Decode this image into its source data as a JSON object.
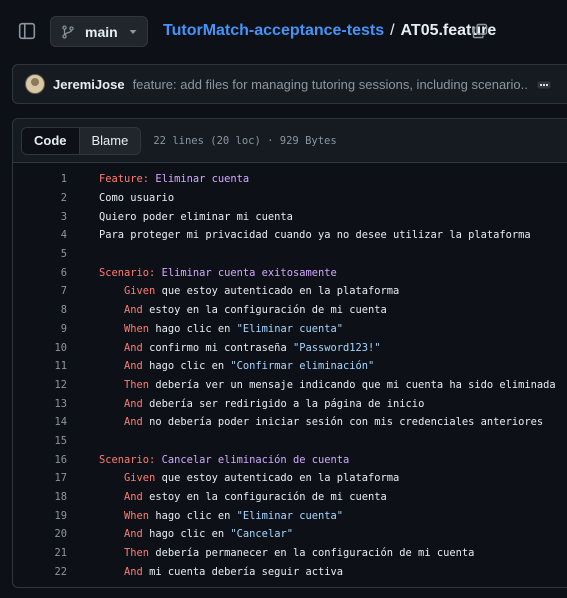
{
  "topbar": {
    "branch": "main",
    "repo": "TutorMatch-acceptance-tests",
    "separator": "/",
    "file": "AT05.feature",
    "icons": {
      "sidebar": "sidebar-toggle-icon",
      "branch": "git-branch-icon",
      "caret": "chevron-down-icon",
      "copy": "copy-icon"
    }
  },
  "commit": {
    "author": "JeremiJose",
    "message": "feature: add files for managing tutoring sessions, including scenario...",
    "icons": {
      "more": "ellipsis-icon"
    }
  },
  "file_header": {
    "tabs": [
      {
        "label": "Code",
        "active": true
      },
      {
        "label": "Blame",
        "active": false
      }
    ],
    "info": "22 lines (20 loc) · 929 Bytes"
  },
  "colors": {
    "keyword": "#ff7b72",
    "string": "#a5d6ff",
    "title": "#d2a8ff",
    "link": "#4493f8",
    "text": "#e6edf3",
    "muted": "#8d96a0"
  },
  "lines": [
    {
      "n": "1",
      "indent": "",
      "kw": "Feature:",
      "text": " ",
      "title": "Eliminar cuenta",
      "str": "",
      "rest": ""
    },
    {
      "n": "2",
      "indent": "",
      "kw": "",
      "text": "Como usuario",
      "title": "",
      "str": "",
      "rest": ""
    },
    {
      "n": "3",
      "indent": "",
      "kw": "",
      "text": "Quiero poder eliminar mi cuenta",
      "title": "",
      "str": "",
      "rest": ""
    },
    {
      "n": "4",
      "indent": "",
      "kw": "",
      "text": "Para proteger mi privacidad cuando ya no desee utilizar la plataforma",
      "title": "",
      "str": "",
      "rest": ""
    },
    {
      "n": "5",
      "indent": "",
      "kw": "",
      "text": "",
      "title": "",
      "str": "",
      "rest": ""
    },
    {
      "n": "6",
      "indent": "",
      "kw": "Scenario:",
      "text": " ",
      "title": "Eliminar cuenta exitosamente",
      "str": "",
      "rest": ""
    },
    {
      "n": "7",
      "indent": "    ",
      "kw": "Given",
      "text": " que estoy autenticado en la plataforma",
      "title": "",
      "str": "",
      "rest": ""
    },
    {
      "n": "8",
      "indent": "    ",
      "kw": "And",
      "text": " estoy en la configuración de mi cuenta",
      "title": "",
      "str": "",
      "rest": ""
    },
    {
      "n": "9",
      "indent": "    ",
      "kw": "When",
      "text": " hago clic en ",
      "title": "",
      "str": "\"Eliminar cuenta\"",
      "rest": ""
    },
    {
      "n": "10",
      "indent": "    ",
      "kw": "And",
      "text": " confirmo mi contraseña ",
      "title": "",
      "str": "\"Password123!\"",
      "rest": ""
    },
    {
      "n": "11",
      "indent": "    ",
      "kw": "And",
      "text": " hago clic en ",
      "title": "",
      "str": "\"Confirmar eliminación\"",
      "rest": ""
    },
    {
      "n": "12",
      "indent": "    ",
      "kw": "Then",
      "text": " debería ver un mensaje indicando que mi cuenta ha sido eliminada",
      "title": "",
      "str": "",
      "rest": ""
    },
    {
      "n": "13",
      "indent": "    ",
      "kw": "And",
      "text": " debería ser redirigido a la página de inicio",
      "title": "",
      "str": "",
      "rest": ""
    },
    {
      "n": "14",
      "indent": "    ",
      "kw": "And",
      "text": " no debería poder iniciar sesión con mis credenciales anteriores",
      "title": "",
      "str": "",
      "rest": ""
    },
    {
      "n": "15",
      "indent": "",
      "kw": "",
      "text": "",
      "title": "",
      "str": "",
      "rest": ""
    },
    {
      "n": "16",
      "indent": "",
      "kw": "Scenario:",
      "text": " ",
      "title": "Cancelar eliminación de cuenta",
      "str": "",
      "rest": ""
    },
    {
      "n": "17",
      "indent": "    ",
      "kw": "Given",
      "text": " que estoy autenticado en la plataforma",
      "title": "",
      "str": "",
      "rest": ""
    },
    {
      "n": "18",
      "indent": "    ",
      "kw": "And",
      "text": " estoy en la configuración de mi cuenta",
      "title": "",
      "str": "",
      "rest": ""
    },
    {
      "n": "19",
      "indent": "    ",
      "kw": "When",
      "text": " hago clic en ",
      "title": "",
      "str": "\"Eliminar cuenta\"",
      "rest": ""
    },
    {
      "n": "20",
      "indent": "    ",
      "kw": "And",
      "text": " hago clic en ",
      "title": "",
      "str": "\"Cancelar\"",
      "rest": ""
    },
    {
      "n": "21",
      "indent": "    ",
      "kw": "Then",
      "text": " debería permanecer en la configuración de mi cuenta",
      "title": "",
      "str": "",
      "rest": ""
    },
    {
      "n": "22",
      "indent": "    ",
      "kw": "And",
      "text": " mi cuenta debería seguir activa",
      "title": "",
      "str": "",
      "rest": ""
    }
  ]
}
